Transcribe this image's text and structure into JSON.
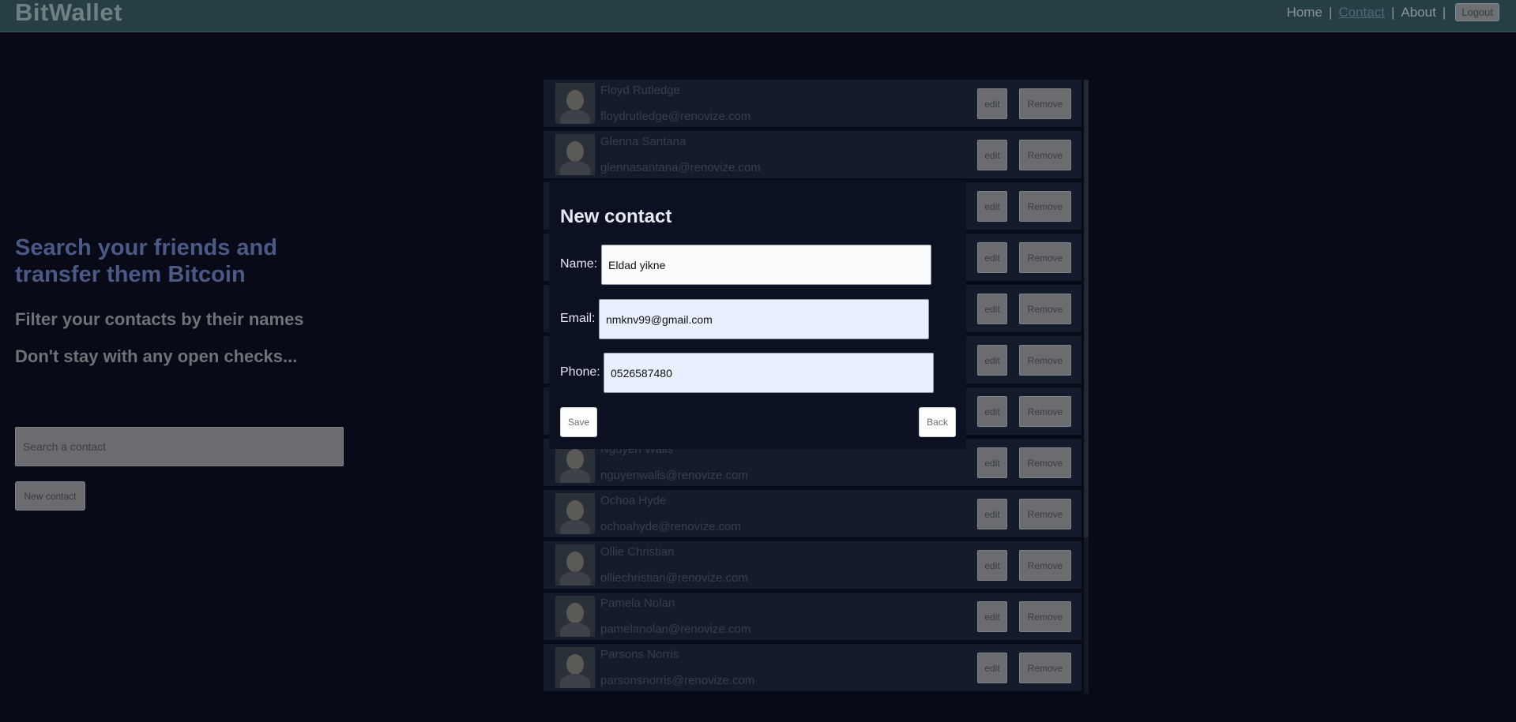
{
  "header": {
    "logo": "BitWallet",
    "nav": [
      {
        "label": "Home",
        "active": false
      },
      {
        "label": "Contact",
        "active": true
      },
      {
        "label": "About",
        "active": false
      }
    ],
    "separator": "|",
    "logout_label": "Logout"
  },
  "hero": {
    "title": "Search your friends and transfer them Bitcoin",
    "subtitle1": "Filter your contacts by their names",
    "subtitle2": "Don't stay with any open checks..."
  },
  "search": {
    "placeholder": "Search a contact"
  },
  "new_contact_label": "New contact",
  "contacts": [
    {
      "name": "Floyd Rutledge",
      "email": "floydrutledge@renovize.com"
    },
    {
      "name": "Glenna Santana",
      "email": "glennasantana@renovize.com"
    },
    {
      "name": "",
      "email": ""
    },
    {
      "name": "",
      "email": ""
    },
    {
      "name": "",
      "email": ""
    },
    {
      "name": "",
      "email": ""
    },
    {
      "name": "",
      "email": ""
    },
    {
      "name": "Nguyen Walls",
      "email": "nguyenwalls@renovize.com"
    },
    {
      "name": "Ochoa Hyde",
      "email": "ochoahyde@renovize.com"
    },
    {
      "name": "Ollie Christian",
      "email": "olliechristian@renovize.com"
    },
    {
      "name": "Pamela Nolan",
      "email": "pamelanolan@renovize.com"
    },
    {
      "name": "Parsons Norris",
      "email": "parsonsnorris@renovize.com"
    }
  ],
  "row_buttons": {
    "edit": "edit",
    "remove": "Remove"
  },
  "modal": {
    "title": "New contact",
    "name_label": "Name:",
    "name_value": "Eldad yikne",
    "email_label": "Email:",
    "email_value": "nmknv99@gmail.com",
    "phone_label": "Phone:",
    "phone_value": "0526587480",
    "save_label": "Save",
    "back_label": "Back"
  }
}
